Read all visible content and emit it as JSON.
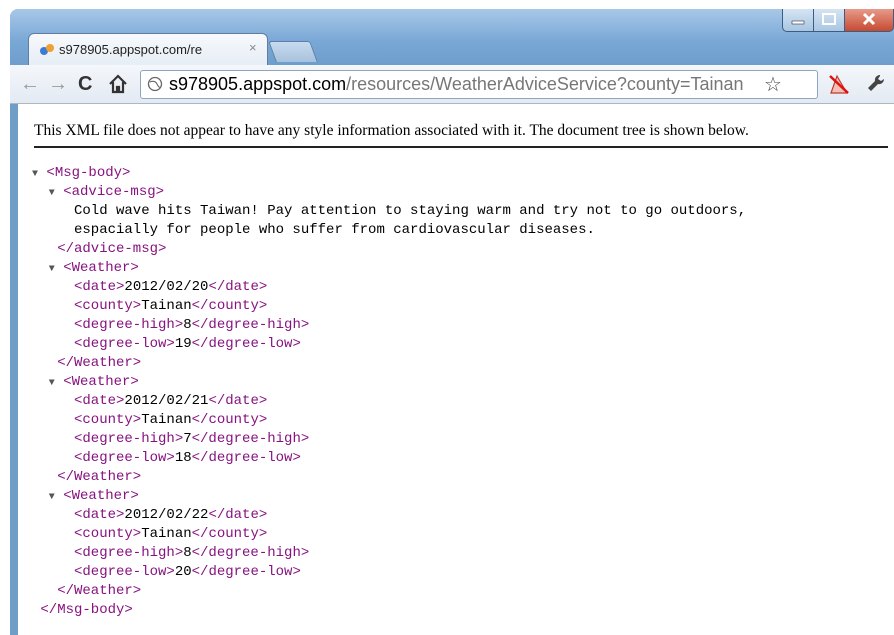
{
  "tab": {
    "title": "s978905.appspot.com/re",
    "close_glyph": "×"
  },
  "toolbar": {
    "back_glyph": "←",
    "forward_glyph": "→",
    "reload_glyph": "C",
    "url_host": "s978905.appspot.com",
    "url_path": "/resources/WeatherAdviceService?county=Tainan",
    "star_glyph": "☆"
  },
  "info_message": "This XML file does not appear to have any style information associated with it. The document tree is shown below.",
  "xml": {
    "collapse_glyph": "▼",
    "root_open": "<Msg-body>",
    "root_close": "</Msg-body>",
    "advice": {
      "open": "<advice-msg>",
      "text_line1": "Cold wave hits Taiwan! Pay attention to staying warm and try not to go outdoors,",
      "text_line2": "espacially for people who suffer from cardiovascular diseases.",
      "close": "</advice-msg>"
    },
    "weather_open": "<Weather>",
    "weather_close": "</Weather>",
    "date_open": "<date>",
    "date_close": "</date>",
    "county_open": "<county>",
    "county_close": "</county>",
    "high_open": "<degree-high>",
    "high_close": "</degree-high>",
    "low_open": "<degree-low>",
    "low_close": "</degree-low>",
    "weathers": [
      {
        "date": "2012/02/20",
        "county": "Tainan",
        "degree_high": "8",
        "degree_low": "19"
      },
      {
        "date": "2012/02/21",
        "county": "Tainan",
        "degree_high": "7",
        "degree_low": "18"
      },
      {
        "date": "2012/02/22",
        "county": "Tainan",
        "degree_high": "8",
        "degree_low": "20"
      }
    ]
  },
  "colors": {
    "tag": "#881280",
    "text": "#000000",
    "frame": "#6f9ec9"
  },
  "icons": [
    "favicon-icon",
    "close-icon",
    "back-icon",
    "forward-icon",
    "reload-icon",
    "home-icon",
    "globe-icon",
    "star-icon",
    "extension-icon",
    "wrench-icon",
    "minimize-icon",
    "maximize-icon",
    "window-close-icon"
  ]
}
